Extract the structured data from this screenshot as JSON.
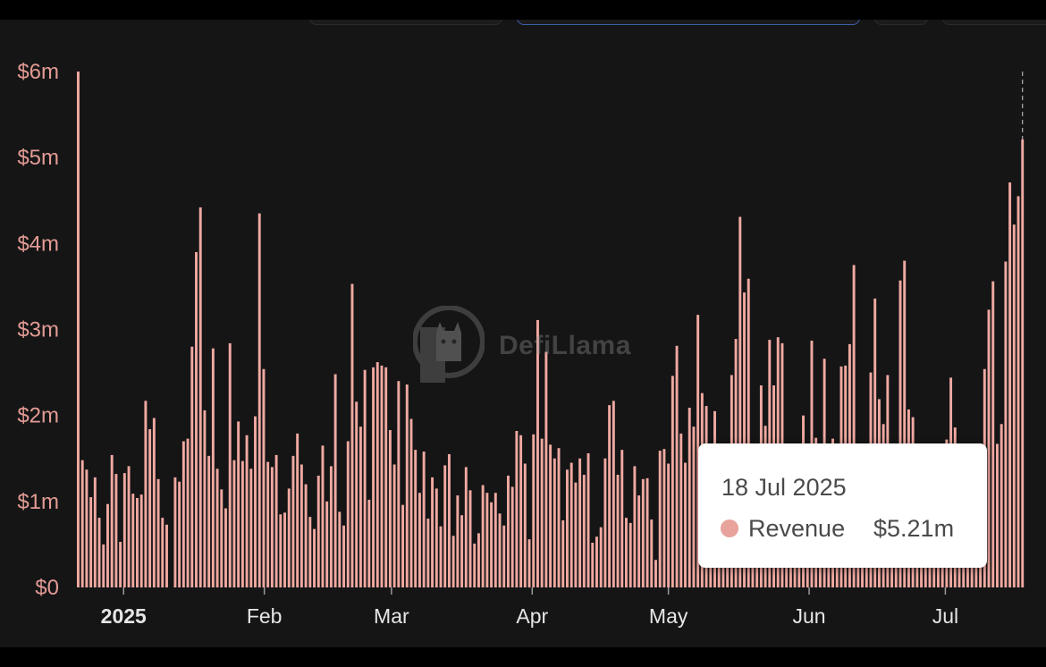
{
  "colors": {
    "bar": "#f0a9a1",
    "bar_stroke": "#c27a73",
    "background": "#151516",
    "axis_text_y": "#e39b94",
    "axis_text_x": "#e6e6e6",
    "tooltip_dot": "#e8a39c"
  },
  "watermark": {
    "text": "DefiLlama",
    "icon": "llama-logo-icon"
  },
  "tooltip": {
    "date": "18 Jul 2025",
    "label": "Revenue",
    "value": "$5.21m"
  },
  "chart_data": {
    "type": "bar",
    "title": "",
    "xlabel": "",
    "ylabel": "",
    "grid": false,
    "legend": "none",
    "unit": "USD",
    "ylim": [
      0,
      6000000
    ],
    "y_ticks": [
      {
        "value": 0,
        "label": "$0"
      },
      {
        "value": 1000000,
        "label": "$1m"
      },
      {
        "value": 2000000,
        "label": "$2m"
      },
      {
        "value": 3000000,
        "label": "$3m"
      },
      {
        "value": 4000000,
        "label": "$4m"
      },
      {
        "value": 5000000,
        "label": "$5m"
      },
      {
        "value": 6000000,
        "label": "$6m"
      }
    ],
    "x_start": "2024-12-22",
    "x_end": "2025-07-18",
    "x_ticks": [
      {
        "date": "2025-01-01",
        "label": "2025",
        "bold": true
      },
      {
        "date": "2025-02-01",
        "label": "Feb",
        "bold": false
      },
      {
        "date": "2025-03-01",
        "label": "Mar",
        "bold": false
      },
      {
        "date": "2025-04-01",
        "label": "Apr",
        "bold": false
      },
      {
        "date": "2025-05-01",
        "label": "May",
        "bold": false
      },
      {
        "date": "2025-06-01",
        "label": "Jun",
        "bold": false
      },
      {
        "date": "2025-07-01",
        "label": "Jul",
        "bold": false
      }
    ],
    "series": [
      {
        "name": "Revenue",
        "values_millions": [
          6.0,
          1.48,
          1.37,
          1.05,
          1.28,
          0.81,
          0.5,
          0.97,
          1.54,
          1.32,
          0.53,
          1.33,
          1.41,
          1.09,
          1.04,
          1.08,
          2.17,
          1.84,
          1.97,
          1.26,
          0.81,
          0.73,
          0,
          1.28,
          1.23,
          1.7,
          1.73,
          2.8,
          3.9,
          4.42,
          2.06,
          1.53,
          2.78,
          1.38,
          1.14,
          0.92,
          2.84,
          1.48,
          1.93,
          1.47,
          1.77,
          1.38,
          1.99,
          4.35,
          2.54,
          1.46,
          1.4,
          1.54,
          0.85,
          0.87,
          1.15,
          1.53,
          1.79,
          1.43,
          1.2,
          0.82,
          0.68,
          1.3,
          1.65,
          1.0,
          1.41,
          2.48,
          0.88,
          0.72,
          1.7,
          3.53,
          2.16,
          1.87,
          2.53,
          1.02,
          2.56,
          2.62,
          2.58,
          2.56,
          1.83,
          1.43,
          2.4,
          0.96,
          2.36,
          1.96,
          1.6,
          1.1,
          1.58,
          0.8,
          1.28,
          1.15,
          0.71,
          1.42,
          1.55,
          0.6,
          1.07,
          0.84,
          1.4,
          1.13,
          0.51,
          0.63,
          1.19,
          1.1,
          0.99,
          1.1,
          0.86,
          0.72,
          1.3,
          1.17,
          1.82,
          1.77,
          1.44,
          0.56,
          1.78,
          3.11,
          1.73,
          2.74,
          1.66,
          1.5,
          1.62,
          0.78,
          1.37,
          1.45,
          1.22,
          1.5,
          1.31,
          1.56,
          0.52,
          0.59,
          0.7,
          1.5,
          2.12,
          2.17,
          1.31,
          1.6,
          0.81,
          0.75,
          1.41,
          1.07,
          1.26,
          1.27,
          0.79,
          0.32,
          1.59,
          1.61,
          1.44,
          2.46,
          2.81,
          1.79,
          1.45,
          2.09,
          1.87,
          3.17,
          2.26,
          2.11,
          1.52,
          2.05,
          1.36,
          1.09,
          1.48,
          2.47,
          2.89,
          4.31,
          3.43,
          3.59,
          1.47,
          1.38,
          2.35,
          1.88,
          2.88,
          2.35,
          2.91,
          2.84,
          1.28,
          1.42,
          1.44,
          1.34,
          2.0,
          1.31,
          2.87,
          1.74,
          1.66,
          2.66,
          1.39,
          1.73,
          1.61,
          2.57,
          2.58,
          2.83,
          3.75,
          1.4,
          1.35,
          1.41,
          2.5,
          3.36,
          2.19,
          1.9,
          2.47,
          1.37,
          1.3,
          3.57,
          3.8,
          2.07,
          1.98,
          1.44,
          1.49,
          1.31,
          1.25,
          1.5,
          1.53,
          1.6,
          1.72,
          2.44,
          1.86,
          1.67,
          1.62,
          1.26,
          1.27,
          1.48,
          1.13,
          2.54,
          3.23,
          3.56,
          1.67,
          1.9,
          3.79,
          4.71,
          4.22,
          4.55,
          5.21
        ]
      }
    ]
  }
}
